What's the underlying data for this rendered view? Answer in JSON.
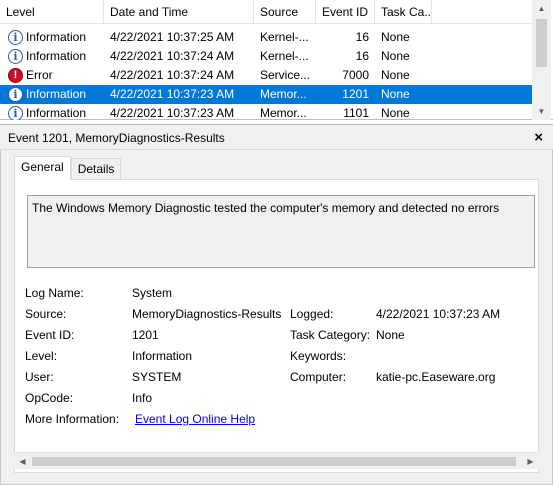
{
  "list": {
    "columns": {
      "level": "Level",
      "date": "Date and Time",
      "source": "Source",
      "event_id": "Event ID",
      "task": "Task Ca..."
    },
    "rows": [
      {
        "icon": "information-icon",
        "level": "Information",
        "date": "4/22/2021 10:37:25 AM",
        "source": "Kernel-...",
        "event_id": "16",
        "task": "None",
        "selected": false
      },
      {
        "icon": "information-icon",
        "level": "Information",
        "date": "4/22/2021 10:37:24 AM",
        "source": "Kernel-...",
        "event_id": "16",
        "task": "None",
        "selected": false
      },
      {
        "icon": "error-icon",
        "level": "Error",
        "date": "4/22/2021 10:37:24 AM",
        "source": "Service...",
        "event_id": "7000",
        "task": "None",
        "selected": false
      },
      {
        "icon": "information-icon",
        "level": "Information",
        "date": "4/22/2021 10:37:23 AM",
        "source": "Memor...",
        "event_id": "1201",
        "task": "None",
        "selected": true
      },
      {
        "icon": "information-icon",
        "level": "Information",
        "date": "4/22/2021 10:37:23 AM",
        "source": "Memor...",
        "event_id": "1101",
        "task": "None",
        "selected": false
      }
    ],
    "icon_glyphs": {
      "information": "i",
      "error": "!"
    }
  },
  "detail": {
    "title": "Event 1201, MemoryDiagnostics-Results",
    "close_glyph": "×",
    "tabs": {
      "general": "General",
      "details": "Details"
    },
    "message": "The Windows Memory Diagnostic tested the computer's memory and detected no errors",
    "labels": {
      "log_name": "Log Name:",
      "source": "Source:",
      "event_id": "Event ID:",
      "level": "Level:",
      "user": "User:",
      "opcode": "OpCode:",
      "more_info": "More Information:",
      "logged": "Logged:",
      "task_category": "Task Category:",
      "keywords": "Keywords:",
      "computer": "Computer:"
    },
    "values": {
      "log_name": "System",
      "source": "MemoryDiagnostics-Results",
      "event_id": "1201",
      "level": "Information",
      "user": "SYSTEM",
      "opcode": "Info",
      "more_info_link": "Event Log Online Help",
      "logged": "4/22/2021 10:37:23 AM",
      "task_category": "None",
      "keywords": "",
      "computer": "katie-pc.Easeware.org"
    }
  },
  "colors": {
    "selection": "#0078d7",
    "error": "#c8102e",
    "info": "#2a5db0",
    "link": "#0000ee"
  }
}
